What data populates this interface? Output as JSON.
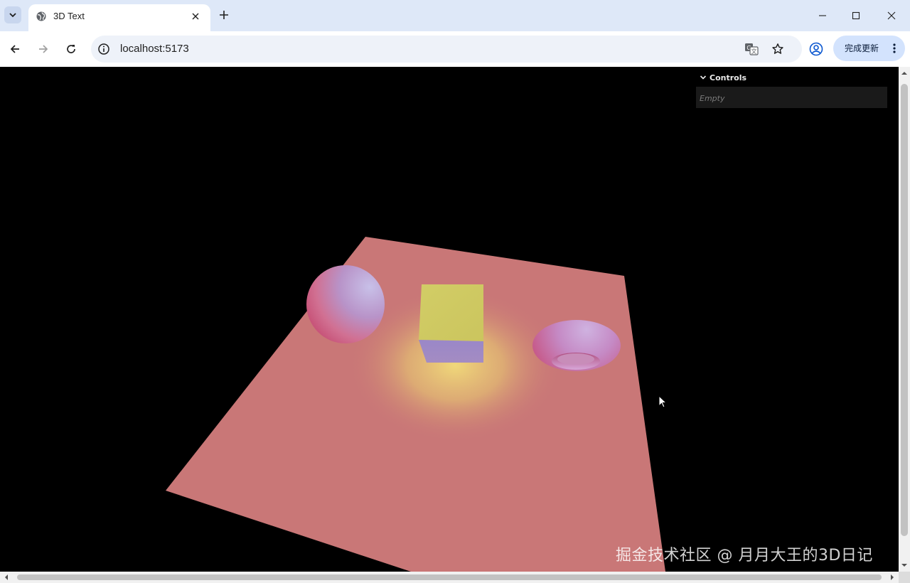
{
  "browser": {
    "tab": {
      "title": "3D Text",
      "favicon": "globe-icon"
    },
    "address_bar": {
      "url": "localhost:5173",
      "info_icon": "info-icon"
    },
    "toolbar_icons": [
      "back-arrow-icon",
      "forward-arrow-icon",
      "reload-icon",
      "translate-icon",
      "star-icon",
      "profile-icon",
      "more-vert-icon"
    ],
    "update_button": {
      "label": "完成更新"
    },
    "window_controls": [
      "minimize-icon",
      "maximize-icon",
      "close-icon"
    ]
  },
  "scene": {
    "background_color": "#000000",
    "plane_color": "#c97777",
    "objects": [
      "sphere",
      "cube",
      "torus",
      "plane"
    ],
    "light": "yellow spotlight on plane"
  },
  "controls_panel": {
    "title": "Controls",
    "empty_text": "Empty"
  },
  "watermark": "掘金技术社区 @ 月月大王的3D日记",
  "colors": {
    "tabstrip": "#dee8f8",
    "update_button": "#d3e3fd",
    "panel": "#1a1a1a"
  }
}
